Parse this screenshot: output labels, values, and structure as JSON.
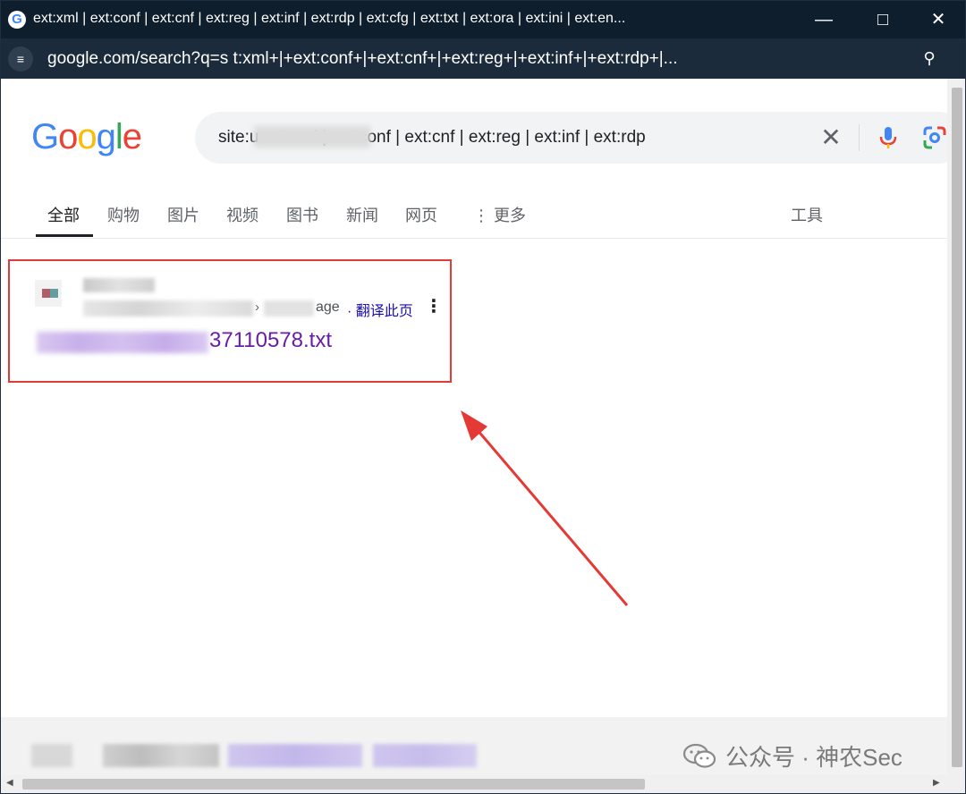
{
  "window": {
    "title": "ext:xml | ext:conf | ext:cnf | ext:reg | ext:inf | ext:rdp | ext:cfg | ext:txt | ext:ora | ext:ini | ext:en...",
    "minimize_icon": "minimize-icon",
    "maximize_icon": "maximize-icon",
    "close_icon": "close-icon"
  },
  "address_bar": {
    "url": "google.com/search?q=s                          t:xml+|+ext:conf+|+ext:cnf+|+ext:reg+|+ext:inf+|+ext:rdp+|..."
  },
  "google": {
    "logo": [
      "G",
      "o",
      "o",
      "g",
      "l",
      "e"
    ],
    "logo_colors": [
      "#4285f4",
      "#ea4335",
      "#fbbc05",
      "#4285f4",
      "#34a853",
      "#ea4335"
    ],
    "search_value": "site:u                    ext:xml | ext:conf | ext:cnf | ext:reg | ext:inf | ext:rdp"
  },
  "tabs": [
    {
      "label": "全部",
      "active": true
    },
    {
      "label": "购物"
    },
    {
      "label": "图片"
    },
    {
      "label": "视频"
    },
    {
      "label": "图书"
    },
    {
      "label": "新闻"
    },
    {
      "label": "网页"
    },
    {
      "label": "更多"
    }
  ],
  "tools_label": "工具",
  "result": {
    "url_tail": "age",
    "url_sep": "›",
    "translate_label": "· 翻译此页",
    "title_suffix": "37110578.txt"
  },
  "watermark": {
    "text": "公众号 · 神农Sec"
  },
  "colors": {
    "titlebar": "#0f1e2d",
    "address_bar": "#1b2b3b",
    "highlight_box": "#e53935",
    "link_visited": "#681da8",
    "translate_link": "#1a0dab"
  }
}
